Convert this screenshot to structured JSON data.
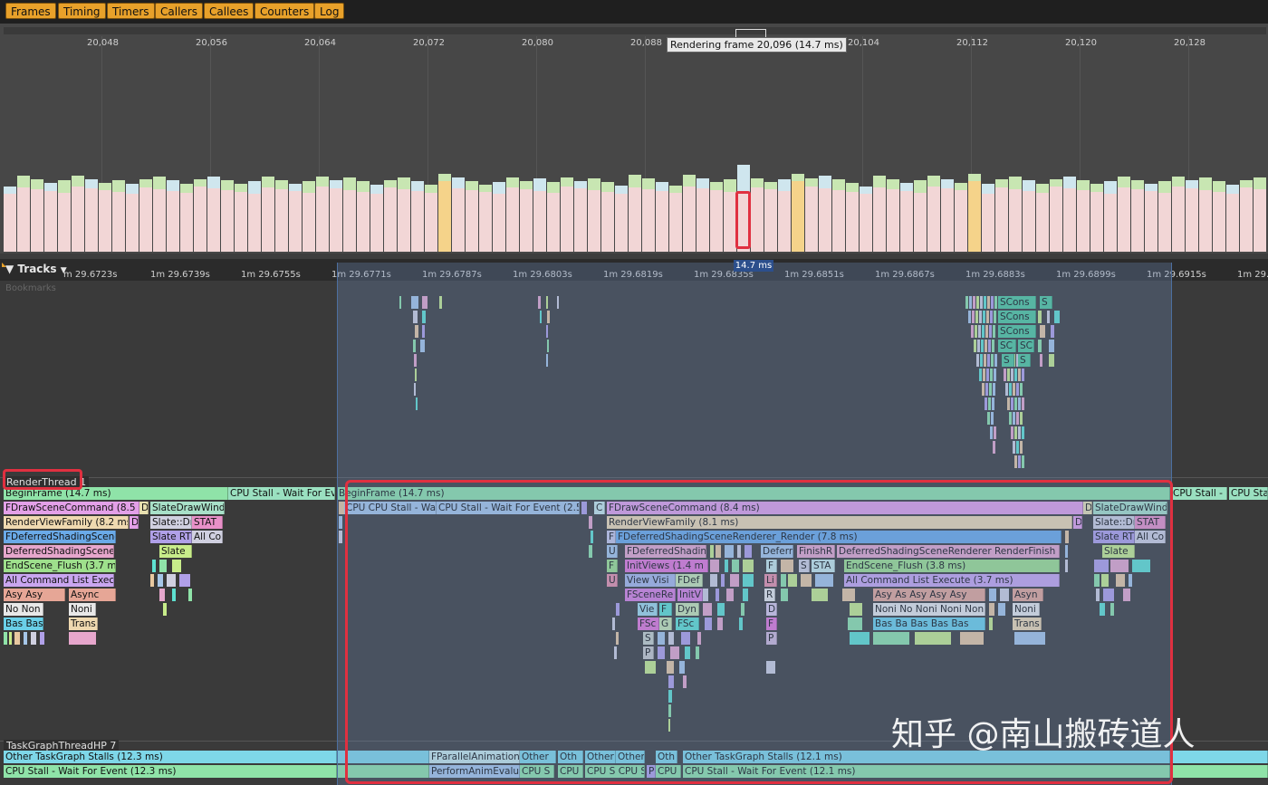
{
  "toolbar": {
    "buttons": [
      "Frames",
      "Timing",
      "Timers",
      "Callers",
      "Callees",
      "Counters",
      "Log"
    ]
  },
  "frames_panel": {
    "tick_labels": [
      "20,048",
      "20,056",
      "20,064",
      "20,072",
      "20,080",
      "20,088",
      "20,104",
      "20,112",
      "20,120",
      "20,128"
    ],
    "hover_tooltip": "Rendering frame 20,096 (14.7 ms)"
  },
  "timing": {
    "tracks_label": "Tracks",
    "bookmarks_label": "Bookmarks",
    "time_labels": [
      "m 29.6723s",
      "1m 29.6739s",
      "1m 29.6755s",
      "1m 29.6771s",
      "1m 29.6787s",
      "1m 29.6803s",
      "1m 29.6819s",
      "1m 29.6835s",
      "1m 29.6851s",
      "1m 29.6867s",
      "1m 29.6883s",
      "1m 29.6899s",
      "1m 29.6915s",
      "1m 29."
    ],
    "selection_label": "14.7 ms"
  },
  "tracks": {
    "render_thread": "RenderThread 1",
    "task_graph": "TaskGraphThreadHP 7"
  },
  "events": {
    "begin_frame_left": "BeginFrame (14.7 ms)",
    "cpu_stall_left": "CPU Stall - Wait For Ev",
    "begin_frame_main": "BeginFrame (14.7 ms)",
    "cpu_stall_right": "CPU Stall -",
    "cpu_sta_right": "CPU Sta",
    "fdraw_left": "FDrawSceneCommand (8.5 ms",
    "d_left": "D",
    "slate_draw_left": "SlateDrawWind",
    "render_view_left": "RenderViewFamily (8.2 ms",
    "d2_left": "D",
    "slate_dr_left": "Slate::Dr",
    "stat_left": "STAT",
    "fdeferred_left": "FDeferredShadingScene",
    "slate_rt_left": "Slate RT",
    "all_co_left": "All Co",
    "deferred_scene_left": "DeferredShadingSceneR",
    "slate_left": "Slate",
    "endscene_left": "EndScene_Flush (3.7 ms",
    "all_cmd_left": "All Command List Execu",
    "asy_left": "Asy Asy",
    "async_left": "Async",
    "no_left": "No  Non",
    "noni_left": "Noni",
    "bas_left": "Bas Bas",
    "trans_left": "Trans",
    "cpu_stall_wa": "CPU  CPU Stall - Wa",
    "cpu_stall_main": "CPU Stall - Wait For Event (2.5",
    "c_small": "C",
    "fdraw_main": "FDrawSceneCommand (8.4 ms)",
    "d_main": "D",
    "slate_draw_main": "SlateDrawWind",
    "render_view_main": "RenderViewFamily (8.1 ms)",
    "d2_main": "D",
    "slate_dr_main": "Slate::Dr",
    "stat_main": "STAT",
    "f_small": "F",
    "fdeferred_render": "FDeferredShadingSceneRenderer_Render (7.8 ms)",
    "slate_rt_main": "Slate RT",
    "all_co_main": "All Co",
    "u_small": "U",
    "fdeferred_shadin": "FDeferredShadin",
    "deferr": "Deferr",
    "finish_r": "FinishR",
    "deferred_finish": "DeferredShadingSceneRenderer RenderFinish (3.",
    "slate_main": "Slate",
    "f2_small": "F",
    "init_views": "InitViews (1.4 m",
    "f3_small": "F",
    "s_small": "S",
    "sta_small": "STA",
    "endscene_main": "EndScene_Flush (3.8 ms)",
    "u2_small": "U",
    "view_visi": "View Visi",
    "fdef_small": "FDef",
    "li_small": "Li",
    "all_cmd_main": "All Command List Execute (3.7 ms)",
    "fscene_re": "FSceneRe",
    "init_v": "InitV",
    "r_small": "R",
    "asy_main": "Asy  As  Asy   Asy   Asy",
    "asyn_main": "Asyn",
    "vie_small": "Vie",
    "f4_small": "F",
    "dyn_small": "Dyn",
    "di_small": "Di",
    "noni_main": "Noni No  Noni Noni  Non",
    "noni2_main": "Noni",
    "fsc_small": "FSc",
    "g_small": "G",
    "fsc2_small": "FSc",
    "f5_small": "F",
    "bas_main": "Bas  Ba  Bas  Bas  Bas",
    "trans_main": "Trans",
    "s2_small": "S",
    "p_small": "P",
    "p2_small": "P",
    "scons_1": "SCons",
    "s_top": "S",
    "scons_2": "SCons",
    "scons_3": "SCons",
    "sc_1": "SC",
    "sc_2": "SC",
    "s_a": "S",
    "s_b": "S",
    "other_tg_left": "Other TaskGraph Stalls (12.3 ms)",
    "cpu_stall_tg_left": "CPU Stall - Wait For Event (12.3 ms)",
    "fparallel": "FParallelAnimation",
    "other_1": "Other",
    "oth_1": "Oth",
    "other_2": "Other",
    "other_3": "Other",
    "oth_2": "Oth",
    "other_tg_right": "Other TaskGraph Stalls (12.1 ms)",
    "perform_anim": "PerformAnimEvalu",
    "cpu_s_1": "CPU S",
    "cpu_1": "CPU",
    "cpu_s_2": "CPU S CPU S",
    "p_tg": "P",
    "cpu_2": "CPU",
    "cpu_stall_tg_right": "CPU Stall - Wait For Event (12.1 ms)"
  },
  "watermark": "知乎 @南山搬砖道人",
  "colors": {
    "toolbar_button": "#e8a12a",
    "selection_highlight": "#e03040",
    "frame_bar": "#f2d6d6",
    "frame_bar_top": "#c8e6b2",
    "frame_bar_hitch": "#f5d38a"
  }
}
